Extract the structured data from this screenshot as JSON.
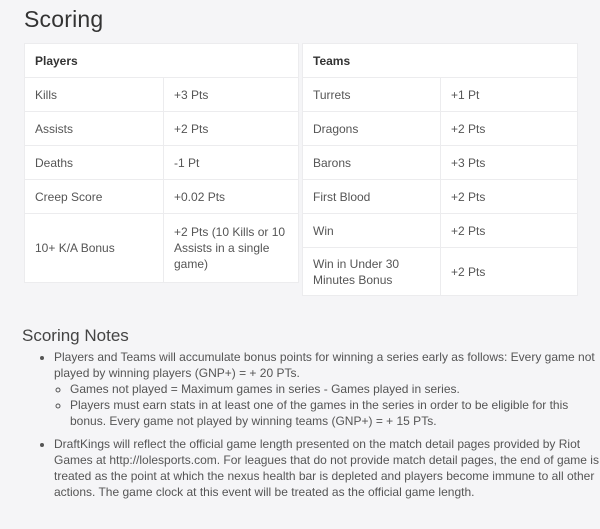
{
  "title": "Scoring",
  "players": {
    "header": "Players",
    "rows": [
      {
        "label": "Kills",
        "value": "+3 Pts"
      },
      {
        "label": "Assists",
        "value": "+2 Pts"
      },
      {
        "label": "Deaths",
        "value": "-1 Pt"
      },
      {
        "label": "Creep Score",
        "value": "+0.02 Pts"
      },
      {
        "label": "10+ K/A Bonus",
        "value": "+2 Pts (10 Kills or 10 Assists in a single game)"
      }
    ]
  },
  "teams": {
    "header": "Teams",
    "rows": [
      {
        "label": "Turrets",
        "value": "+1 Pt"
      },
      {
        "label": "Dragons",
        "value": "+2 Pts"
      },
      {
        "label": "Barons",
        "value": "+3 Pts"
      },
      {
        "label": "First Blood",
        "value": "+2 Pts"
      },
      {
        "label": "Win",
        "value": "+2 Pts"
      },
      {
        "label": "Win in Under 30 Minutes Bonus",
        "value": "+2 Pts"
      }
    ]
  },
  "notes": {
    "title": "Scoring Notes",
    "items": [
      {
        "text": "Players and Teams will accumulate bonus points for winning a series early as follows: Every game not played by winning players (GNP+) = + 20 PTs.",
        "sub": [
          "Games not played = Maximum games in series - Games played in series.",
          "Players must earn stats in at least one of the games in the series in order to be eligible for this bonus. Every game not played by winning teams (GNP+) = + 15 PTs."
        ]
      },
      {
        "text": "DraftKings will reflect the official game length presented on the match detail pages provided by Riot Games at http://lolesports.com. For leagues that do not provide match detail pages, the end of game is treated as the point at which the nexus health bar is depleted and players become immune to all other actions. The game clock at this event will be treated as the official game length."
      }
    ]
  }
}
